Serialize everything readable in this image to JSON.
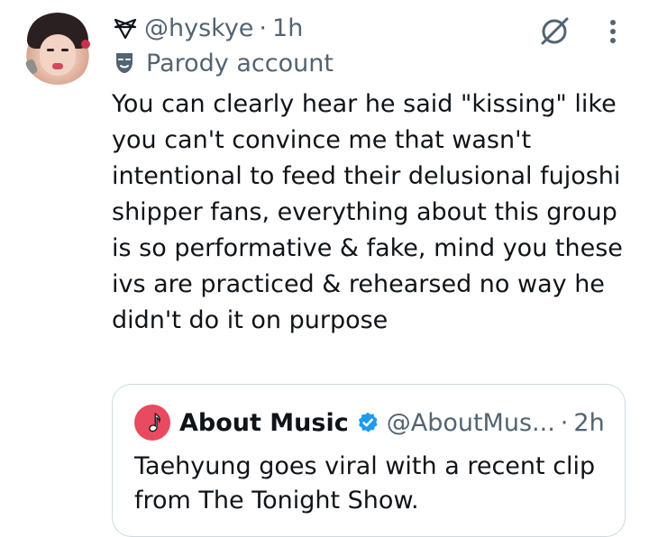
{
  "tweet": {
    "handle": "@hyskye",
    "dot": "·",
    "time": "1h",
    "parody_label": "Parody account",
    "text": "You can clearly hear he said \"kissing\" like you can't convince me that wasn't intentional to feed their delusional fujoshi shipper fans, everything about this group is so performative & fake, mind you these ivs are practiced & rehearsed no way he didn't do it on purpose"
  },
  "quote": {
    "name": "About Music",
    "handle": "@AboutMus...",
    "dot": "·",
    "time": "2h",
    "text": "Taehyung goes viral with a recent clip from The Tonight Show."
  },
  "icons": {
    "handle_prefix": "pentagram-icon",
    "parody": "mask-icon",
    "grok": "grok-icon",
    "more": "more-vertical-icon",
    "verified": "verified-badge-icon",
    "quote_avatar": "music-note-icon"
  },
  "colors": {
    "secondary_text": "#536471",
    "primary_text": "#0f1419",
    "verified_blue": "#1d9bf0",
    "quote_avatar_red": "#e84a5f",
    "border": "#cfd9de"
  }
}
